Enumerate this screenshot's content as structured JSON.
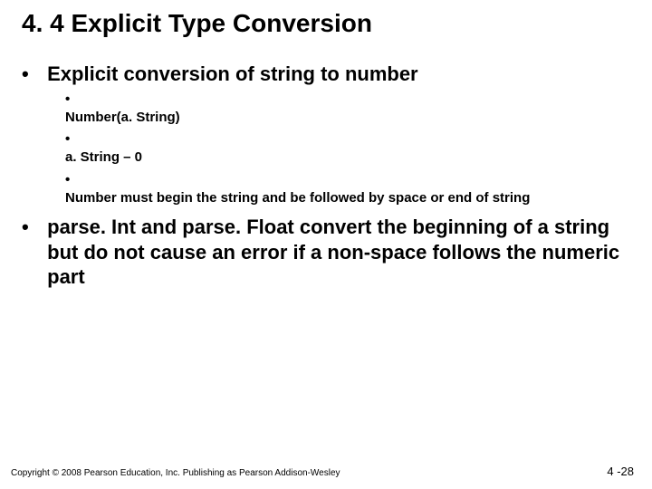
{
  "title": "4. 4 Explicit Type Conversion",
  "bullets": [
    {
      "level": 1,
      "text": "Explicit conversion of string to number"
    },
    {
      "level": 2,
      "text": "Number(a. String)"
    },
    {
      "level": 2,
      "text": "a. String – 0"
    },
    {
      "level": 2,
      "text": "Number must begin the string and be followed by space or end of string"
    },
    {
      "level": 1,
      "text": "parse. Int and parse. Float convert the beginning of a string but do not cause an error if a non-space follows the numeric part"
    }
  ],
  "footer": {
    "copyright": "Copyright © 2008 Pearson Education, Inc. Publishing as Pearson Addison-Wesley",
    "pageNumber": "4 -28"
  },
  "glyphs": {
    "bullet1": "•",
    "bullet2": "•"
  }
}
